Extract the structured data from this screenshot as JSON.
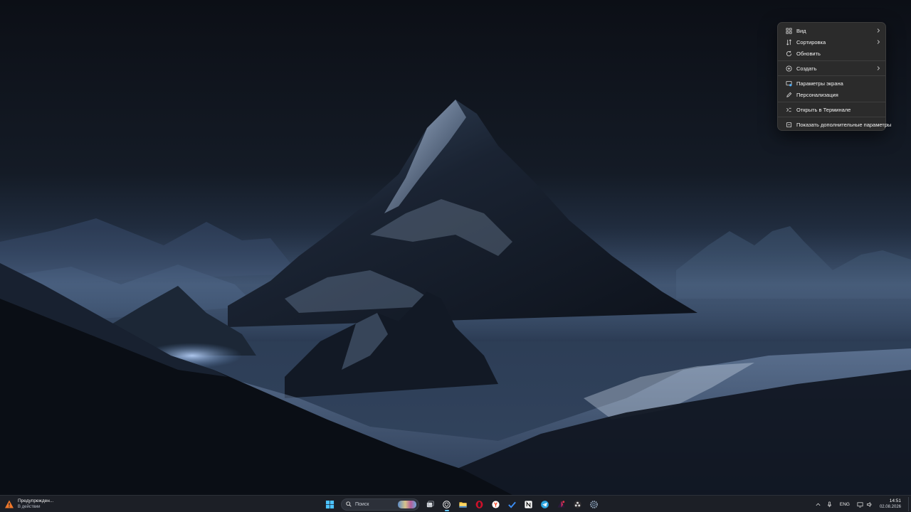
{
  "context_menu": {
    "items": [
      {
        "label": "Вид",
        "icon": "grid-view-icon",
        "submenu": true
      },
      {
        "label": "Сортировка",
        "icon": "sort-icon",
        "submenu": true
      },
      {
        "label": "Обновить",
        "icon": "refresh-icon",
        "submenu": false
      },
      {
        "label": "Создать",
        "icon": "plus-circle-icon",
        "submenu": true
      },
      {
        "label": "Параметры экрана",
        "icon": "display-settings-icon",
        "submenu": false
      },
      {
        "label": "Персонализация",
        "icon": "pen-icon",
        "submenu": false
      },
      {
        "label": "Открыть в Терминале",
        "icon": "terminal-icon",
        "submenu": false
      },
      {
        "label": "Показать дополнительные параметры",
        "icon": "more-options-icon",
        "submenu": false
      }
    ]
  },
  "taskbar": {
    "notification": {
      "title": "Предупрежден...",
      "subtitle": "В действии",
      "icon": "warning-triangle-icon",
      "color": "#f0782a"
    },
    "search_placeholder": "Поиск",
    "apps": [
      {
        "name": "start-button",
        "icon": "windows-logo-icon"
      },
      {
        "name": "task-view-button",
        "icon": "task-view-icon"
      },
      {
        "name": "app-chatgpt",
        "icon": "openai-icon"
      },
      {
        "name": "app-file-explorer",
        "icon": "folder-icon"
      },
      {
        "name": "app-opera",
        "icon": "opera-icon"
      },
      {
        "name": "app-yandex-browser",
        "icon": "yandex-icon"
      },
      {
        "name": "app-todo",
        "icon": "checkmark-icon"
      },
      {
        "name": "app-notion",
        "icon": "notion-icon"
      },
      {
        "name": "app-telegram",
        "icon": "telegram-icon"
      },
      {
        "name": "app-affinity",
        "icon": "affinity-icon"
      },
      {
        "name": "app-obs",
        "icon": "obs-icon"
      },
      {
        "name": "app-settings",
        "icon": "gear-icon"
      }
    ],
    "tray": {
      "language": "ENG",
      "time": "14:51",
      "date": "02.08.2026"
    },
    "accent": "#60c5ff"
  }
}
